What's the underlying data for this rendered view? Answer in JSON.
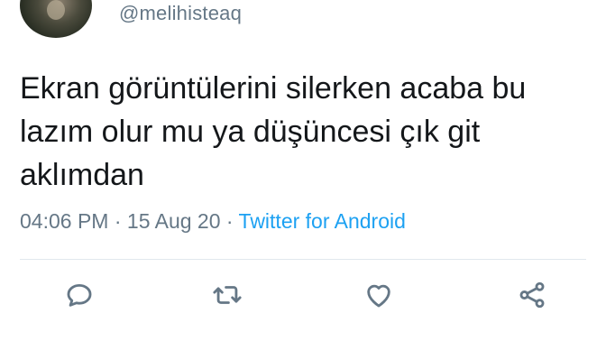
{
  "tweet": {
    "handle": "@melihisteaq",
    "text": "Ekran görüntülerini silerken acaba bu lazım olur mu ya düşüncesi çık git aklımdan",
    "time": "04:06 PM",
    "separator": " · ",
    "date": "15 Aug 20",
    "source": "Twitter for Android"
  },
  "actions": {
    "reply_icon": "reply-icon",
    "retweet_icon": "retweet-icon",
    "like_icon": "heart-icon",
    "share_icon": "share-icon"
  },
  "colors": {
    "text": "#14171a",
    "muted": "#657786",
    "link": "#1da1f2",
    "divider": "#e1e8ed"
  }
}
